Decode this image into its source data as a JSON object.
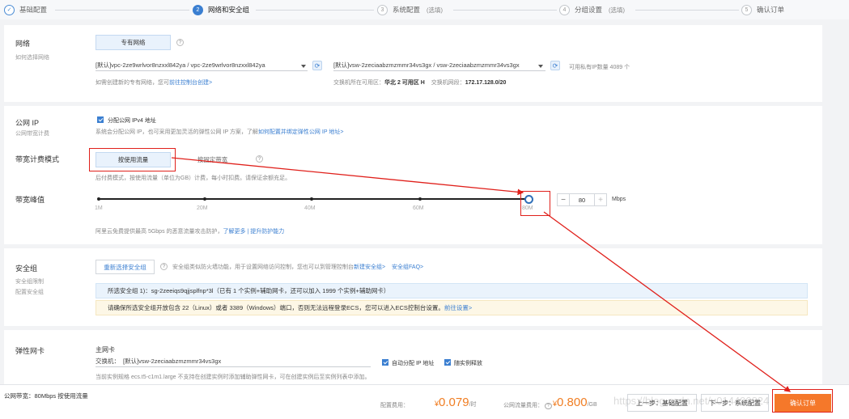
{
  "steps": [
    {
      "num": "✓",
      "label": "基础配置",
      "opt": ""
    },
    {
      "num": "2",
      "label": "网络和安全组",
      "opt": ""
    },
    {
      "num": "3",
      "label": "系统配置",
      "opt": "(选填)"
    },
    {
      "num": "4",
      "label": "分组设置",
      "opt": "(选填)"
    },
    {
      "num": "5",
      "label": "确认订单",
      "opt": ""
    }
  ],
  "network": {
    "title": "网络",
    "sub": "如何选择网络",
    "type_label": "专有网络",
    "help": "?",
    "vpc_value": "[默认]vpc-2ze9wrlvor8nzxxl842ya / vpc-2ze9wrlvor8nzxxl842ya",
    "vsw_value": "[默认]vsw-2zeciaabzmzmmr34vs3gx / vsw-2zeciaabzmzmmr34vs3gx",
    "available": "可用私有IP数量 4089 个",
    "vpc_hint_pre": "如需创建新的专有网络，您可",
    "vpc_hint_link": "前往控制台创建>",
    "zone_pre": "交换机所在可用区：",
    "zone": "华北 2 可用区 H",
    "cidr_pre": "交换机网段：",
    "cidr": "172.17.128.0/20"
  },
  "public_ip": {
    "title": "公网 IP",
    "sub": "公网带宽计费",
    "checkbox_label": "分配公网 IPv4 地址",
    "desc": "系统会分配公网 IP，也可采用更加灵活的弹性公网 IP 方案，了解",
    "desc_link": "如何配置并绑定弹性公网 IP 地址>"
  },
  "billing": {
    "title": "带宽计费模式",
    "by_traffic": "按使用流量",
    "by_bandwidth": "按固定带宽",
    "help": "?",
    "desc": "后付费模式，按使用流量（单位为GB）计费，每小时扣费。请保证余额充足。"
  },
  "bandwidth": {
    "title": "带宽峰值",
    "ticks": [
      "1M",
      "20M",
      "40M",
      "60M",
      "80M"
    ],
    "value": "80",
    "unit": "Mbps",
    "minus": "−",
    "plus": "+",
    "level": 1.0,
    "note": "阿里云免费提供最高 5Gbps 的恶意流量攻击防护，",
    "note_link1": "了解更多",
    "note_sep": " | ",
    "note_link2": "提升防护能力"
  },
  "security": {
    "title": "安全组",
    "sub1": "安全组限制",
    "sub2": "配置安全组",
    "btn": "重新选择安全组",
    "help": "?",
    "desc": "安全组类似防火墙功能，用于设置网络访问控制，您也可以到管理控制台",
    "desc_link1": "新建安全组>",
    "desc_link2": "安全组FAQ>",
    "selected": "所选安全组 1)：sg-2zeeiqs9qjjsplfnp*3l（已有 1 个实例+辅助网卡，还可以加入 1999 个实例+辅助网卡）",
    "warn": "请确保所选安全组开放包含 22（Linux）或者 3389（Windows）端口，否则无法远程登录ECS，您可以进入ECS控制台设置。",
    "warn_link": "前往设置>"
  },
  "eni": {
    "title": "弹性网卡",
    "primary": "主网卡",
    "vsw_label": "交换机：",
    "vsw_value": "[默认]vsw-2zeciaabzmzmmr34vs3gx",
    "auto_ip": "自动分配 IP 地址",
    "release": "随实例释放",
    "note": "当前实例规格 ecs.t5-c1m1.large 不支持在创建实例时添加辅助弹性网卡，可在创建实例后至实例列表中添加。"
  },
  "footer": {
    "bandwidth_label": "公网带宽：80Mbps 按使用流量",
    "config_fee_label": "配置费用：",
    "config_fee_currency": "¥",
    "config_fee": "0.079",
    "config_fee_unit": "/时",
    "traffic_fee_label": "公网流量费用：",
    "traffic_fee_currency": "¥",
    "traffic_fee": "0.800",
    "traffic_fee_unit": "/GB",
    "prev": "上一步：基础配置",
    "next": "下一步：系统配置",
    "confirm": "确认订单"
  },
  "watermark": "https://blog.csdn.net/u014490824",
  "colors": {
    "accent": "#3b7fd1",
    "order": "#f5782a",
    "annotation": "#e0201b",
    "price": "#f07d22"
  }
}
